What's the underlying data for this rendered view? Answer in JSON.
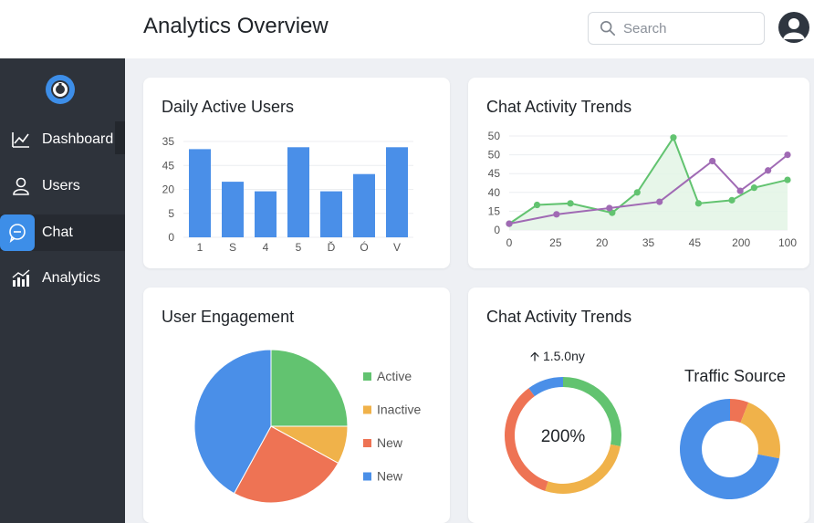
{
  "header": {
    "title": "Analytics Overview",
    "search_placeholder": "Search"
  },
  "sidebar": {
    "items": [
      {
        "label": "Dashboard",
        "icon": "trend-line-icon"
      },
      {
        "label": "Users",
        "icon": "user-icon"
      },
      {
        "label": "Chat",
        "icon": "chat-bubble-icon",
        "active": true
      },
      {
        "label": "Analytics",
        "icon": "bar-analytics-icon"
      }
    ]
  },
  "colors": {
    "accent": "#3d8ee8",
    "sidebar": "#2e333b",
    "green": "#62c370",
    "purple": "#a06ab4",
    "orange": "#f0b24a",
    "red": "#ee7354"
  },
  "cards": {
    "daily_active_users": {
      "title": "Daily Active Users"
    },
    "chat_trends_line": {
      "title": "Chat Activity Trends"
    },
    "user_engagement": {
      "title": "User Engagement"
    },
    "chat_trends_donut": {
      "title": "Chat Activity Trends",
      "caption": "1.5.0ny",
      "center_label": "200%"
    },
    "traffic_source": {
      "title": "Traffic Source"
    }
  },
  "chart_data": [
    {
      "type": "bar",
      "title": "Daily Active Users",
      "categories": [
        "1",
        "S",
        "4",
        "5",
        "Ď",
        "Ó",
        "V"
      ],
      "values": [
        46,
        29,
        24,
        47,
        24,
        33,
        47
      ],
      "ylim": [
        0,
        50
      ],
      "y_tick_labels": [
        "0",
        "5",
        "20",
        "45",
        "35"
      ]
    },
    {
      "type": "line",
      "title": "Chat Activity Trends",
      "x_tick_labels": [
        "0",
        "25",
        "20",
        "35",
        "45",
        "200",
        "100"
      ],
      "y_tick_labels": [
        "0",
        "15",
        "40",
        "45",
        "50",
        "50"
      ],
      "ylim": [
        0,
        60
      ],
      "series": [
        {
          "color": "#62c370",
          "x": [
            0,
            10,
            22,
            37,
            46,
            59,
            68,
            80,
            88,
            100
          ],
          "y": [
            4,
            16,
            17,
            11,
            24,
            59,
            17,
            19,
            27,
            32
          ]
        },
        {
          "color": "#a06ab4",
          "x": [
            0,
            17,
            36,
            54,
            73,
            83,
            93,
            100
          ],
          "y": [
            4,
            10,
            14,
            18,
            44,
            25,
            38,
            48
          ]
        }
      ]
    },
    {
      "type": "pie",
      "title": "User Engagement",
      "slices": [
        {
          "label": "Active",
          "value": 25,
          "color": "#62c370"
        },
        {
          "label": "Inactive",
          "value": 8,
          "color": "#f0b24a"
        },
        {
          "label": "New",
          "value": 25,
          "color": "#ee7354"
        },
        {
          "label": "New",
          "value": 42,
          "color": "#4a8fe8"
        }
      ]
    },
    {
      "type": "pie",
      "title": "Chat Activity Trends",
      "center_label": "200%",
      "slices": [
        {
          "value": 28,
          "color": "#62c370"
        },
        {
          "value": 27,
          "color": "#f0b24a"
        },
        {
          "value": 35,
          "color": "#ee7354"
        },
        {
          "value": 10,
          "color": "#4a8fe8"
        }
      ]
    },
    {
      "type": "pie",
      "title": "Traffic Source",
      "slices": [
        {
          "value": 6,
          "color": "#ee7354"
        },
        {
          "value": 22,
          "color": "#f0b24a"
        },
        {
          "value": 72,
          "color": "#4a8fe8"
        }
      ]
    }
  ]
}
